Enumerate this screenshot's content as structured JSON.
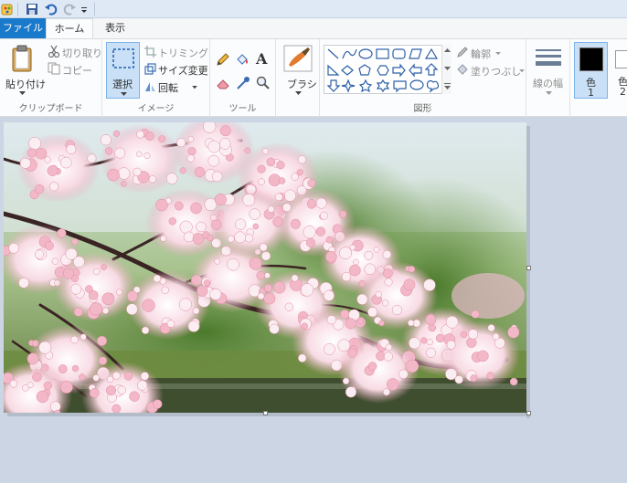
{
  "tabs": {
    "file": "ファイル",
    "home": "ホーム",
    "view": "表示"
  },
  "clipboard": {
    "paste": "貼り付け",
    "cut": "切り取り",
    "copy": "コピー",
    "group_label": "クリップボード"
  },
  "image": {
    "select": "選択",
    "crop": "トリミング",
    "resize": "サイズ変更",
    "rotate": "回転",
    "group_label": "イメージ"
  },
  "tools": {
    "group_label": "ツール"
  },
  "brushes": {
    "label": "ブラシ"
  },
  "shapes": {
    "outline": "輪郭",
    "fill": "塗りつぶし",
    "group_label": "図形"
  },
  "size": {
    "label": "線の幅"
  },
  "colors": {
    "color1_label": "色",
    "color1_num": "1",
    "color2_label": "色",
    "color2_num": "2",
    "color1_value": "#000000",
    "color2_value": "#ffffff"
  },
  "canvas": {
    "subject": "cherry-blossom-photo"
  }
}
